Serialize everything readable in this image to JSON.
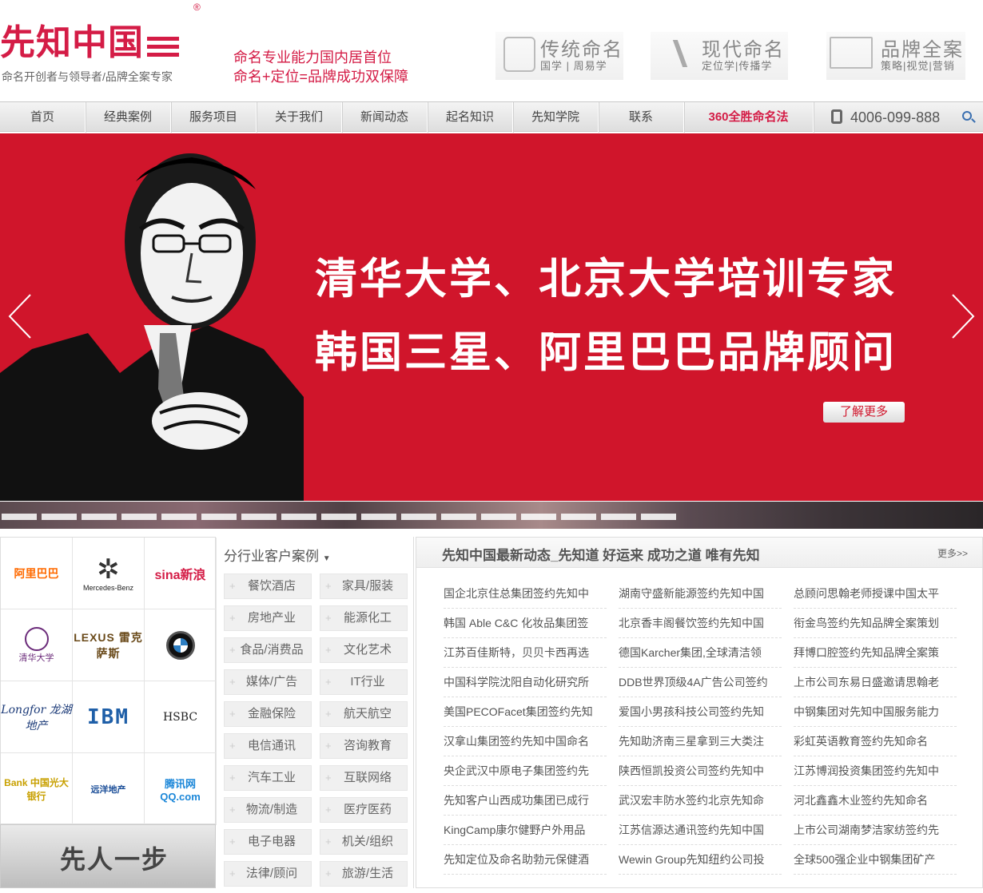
{
  "header": {
    "logo_text": "先知中国",
    "logo_reg": "®",
    "logo_sub": "命名开创者与领导者/品牌全案专家",
    "slogan_line1": "命名专业能力国内居首位",
    "slogan_line2": "命名+定位=品牌成功双保障",
    "features": [
      {
        "title": "传统命名",
        "sub": "国学 | 周易学"
      },
      {
        "title": "现代命名",
        "sub": "定位学|传播学"
      },
      {
        "title": "品牌全案",
        "sub": "策略|视觉|营销"
      }
    ]
  },
  "nav": {
    "items": [
      "首页",
      "经典案例",
      "服务项目",
      "关于我们",
      "新闻动态",
      "起名知识",
      "先知学院",
      "联系",
      "360全胜命名法"
    ],
    "phone": "4006-099-888"
  },
  "banner": {
    "line1": "清华大学、北京大学培训专家",
    "line2": "韩国三星、阿里巴巴品牌顾问",
    "more_label": "了解更多"
  },
  "clients": {
    "logos": [
      "阿里巴巴",
      "Mercedes-Benz",
      "sina新浪",
      "清华大学",
      "LEXUS 雷克萨斯",
      "BMW",
      "Longfor 龙湖地产",
      "IBM",
      "HSBC",
      "Bank 中国光大银行",
      "远洋地产",
      "腾讯网 QQ.com"
    ],
    "slogan": "先人一步"
  },
  "industry": {
    "title": "分行业客户案例",
    "categories": [
      "餐饮酒店",
      "家具/服装",
      "房地产业",
      "能源化工",
      "食品/消费品",
      "文化艺术",
      "媒体/广告",
      "IT行业",
      "金融保险",
      "航天航空",
      "电信通讯",
      "咨询教育",
      "汽车工业",
      "互联网络",
      "物流/制造",
      "医疗医药",
      "电子电器",
      "机关/组织",
      "法律/顾问",
      "旅游/生活"
    ]
  },
  "news": {
    "title": "先知中国最新动态_先知道 好运来 成功之道 唯有先知",
    "more": "更多>>",
    "items": [
      "国企北京住总集团签约先知中",
      "湖南守盛新能源签约先知中国",
      "总顾问思翰老师授课中国太平",
      "韩国 Able C&C 化妆品集团签",
      "北京香丰阁餐饮签约先知中国",
      "衔金鸟签约先知品牌全案策划",
      "江苏百佳斯特，贝贝卡西再选",
      "德国Karcher集团,全球清洁领",
      "拜博口腔签约先知品牌全案策",
      "中国科学院沈阳自动化研究所",
      "DDB世界顶级4A广告公司签约",
      "上市公司东易日盛邀请思翰老",
      "美国PECOFacet集团签约先知",
      "爱国小男孩科技公司签约先知",
      "中钢集团对先知中国服务能力",
      "汉拿山集团签约先知中国命名",
      "先知助济南三星拿到三大类注",
      "彩虹英语教育签约先知命名",
      "央企武汉中原电子集团签约先",
      "陕西恒凯投资公司签约先知中",
      "江苏博润投资集团签约先知中",
      "先知客户山西成功集团已成行",
      "武汉宏丰防水签约北京先知命",
      "河北鑫鑫木业签约先知命名",
      "KingCamp康尔健野户外用品",
      "江苏信源达通讯签约先知中国",
      "上市公司湖南梦洁家纺签约先",
      "先知定位及命名助勃元保健酒",
      "Wewin Group先知纽约公司投",
      "全球500强企业中钢集团矿产"
    ]
  },
  "colors": {
    "brand": "#d41c46",
    "banner": "#d0152b"
  }
}
